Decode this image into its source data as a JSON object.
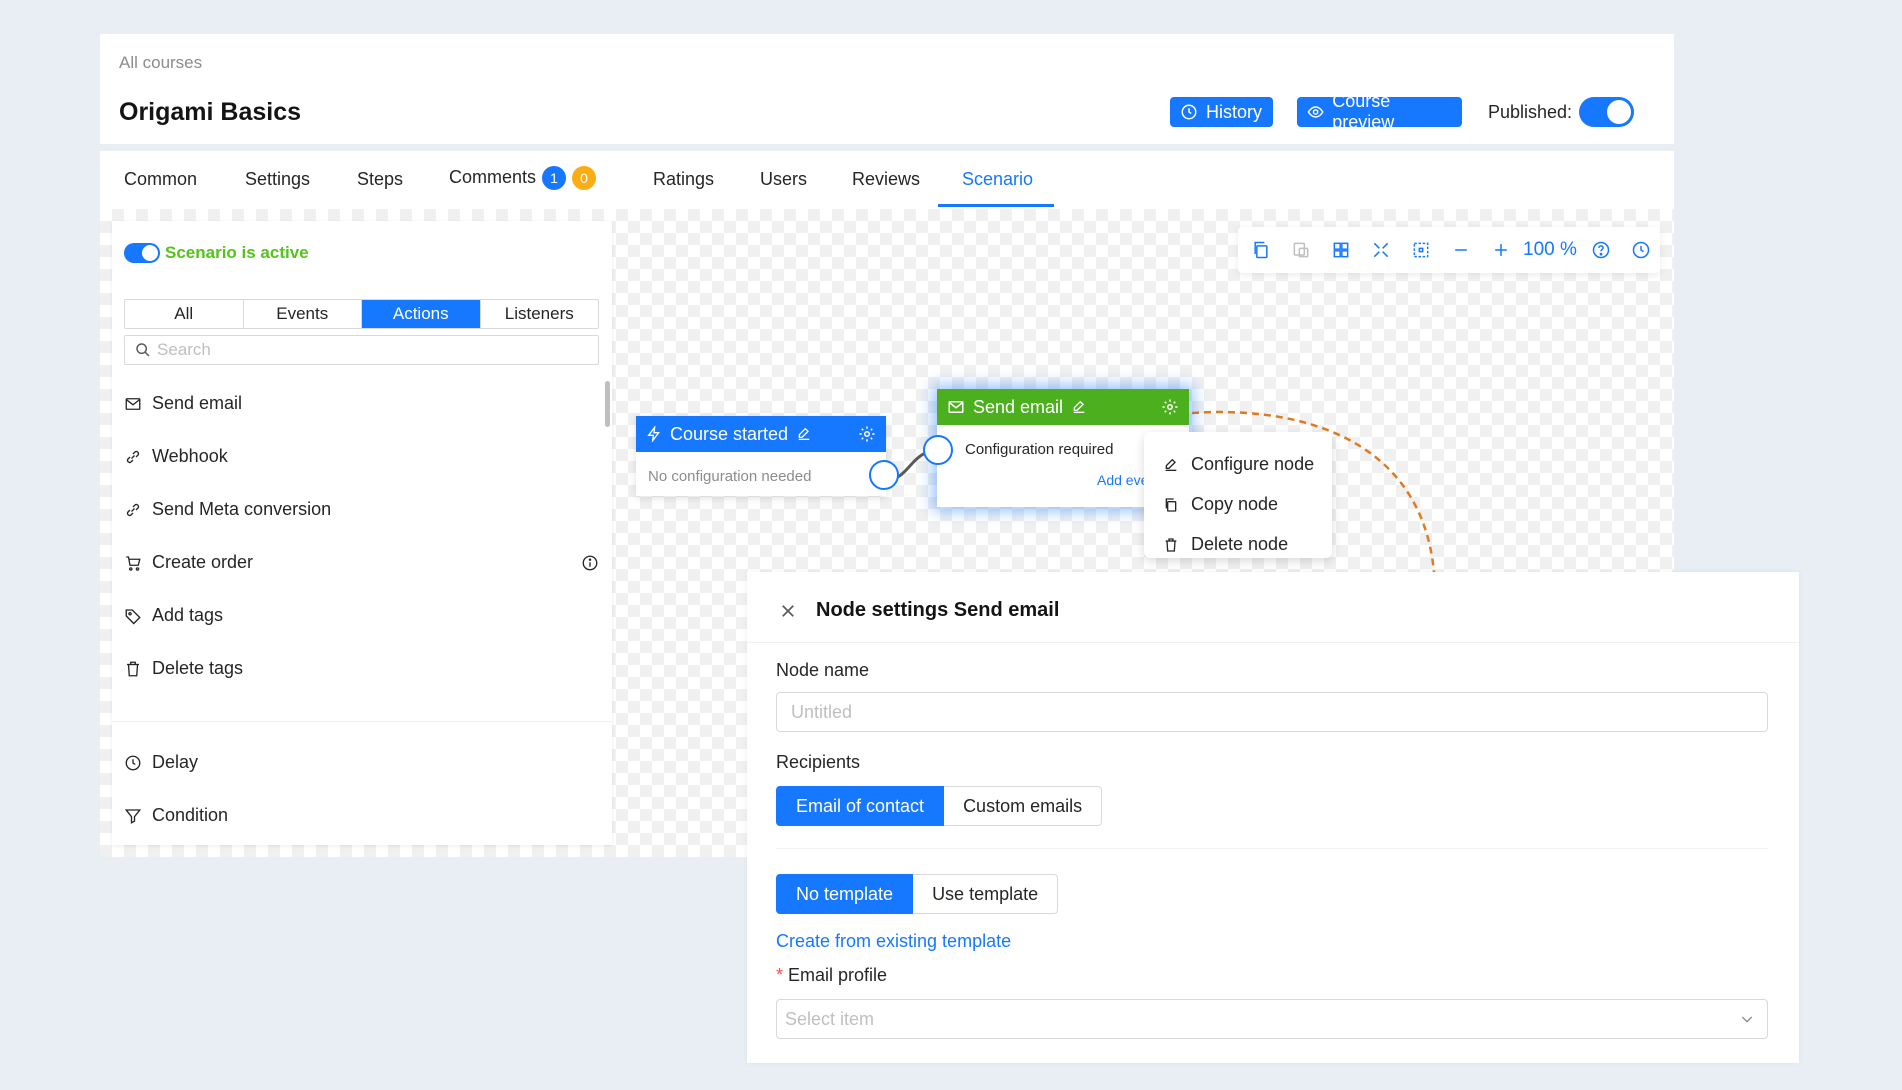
{
  "header": {
    "breadcrumb": "All courses",
    "title": "Origami Basics",
    "history_label": "History",
    "preview_label": "Course preview",
    "published_label": "Published:",
    "published": true
  },
  "tabs": [
    {
      "label": "Common"
    },
    {
      "label": "Settings"
    },
    {
      "label": "Steps"
    },
    {
      "label": "Comments",
      "badges": [
        "1",
        "0"
      ]
    },
    {
      "label": "Ratings"
    },
    {
      "label": "Users"
    },
    {
      "label": "Reviews"
    },
    {
      "label": "Scenario",
      "active": true
    }
  ],
  "colors": {
    "primary": "#1677ff",
    "success": "#52c41a",
    "node_green": "#4caf1e",
    "badge_blue": "#1677ff",
    "badge_orange": "#faad14",
    "connector_orange": "#e07a1f"
  },
  "panel": {
    "scenario_active_label": "Scenario is active",
    "filters": [
      {
        "label": "All"
      },
      {
        "label": "Events"
      },
      {
        "label": "Actions",
        "active": true
      },
      {
        "label": "Listeners"
      }
    ],
    "search_placeholder": "Search",
    "items": [
      {
        "label": "Send email",
        "icon": "mail-icon"
      },
      {
        "label": "Webhook",
        "icon": "link-icon"
      },
      {
        "label": "Send Meta conversion",
        "icon": "link-icon"
      },
      {
        "label": "Create order",
        "icon": "cart-icon",
        "info": true
      },
      {
        "label": "Add tags",
        "icon": "tag-icon"
      },
      {
        "label": "Delete tags",
        "icon": "trash-icon"
      }
    ],
    "flow_items": [
      {
        "label": "Delay",
        "icon": "clock-icon"
      },
      {
        "label": "Condition",
        "icon": "filter-icon"
      }
    ]
  },
  "toolbar": {
    "zoom": "100 %",
    "icons": [
      "copy-icon",
      "paste-icon",
      "grid-icon",
      "fit-icon",
      "select-icon",
      "zoom-out-icon",
      "zoom-in-icon",
      "help-icon",
      "history-icon"
    ]
  },
  "nodes": {
    "course_started": {
      "title": "Course started",
      "body": "No configuration needed"
    },
    "send_email": {
      "title": "Send email",
      "body": "Configuration required",
      "add_label": "Add eve"
    }
  },
  "context_menu": {
    "items": [
      {
        "label": "Configure node",
        "icon": "edit-icon"
      },
      {
        "label": "Copy node",
        "icon": "copy-icon"
      },
      {
        "label": "Delete node",
        "icon": "trash-icon"
      }
    ]
  },
  "drawer": {
    "title": "Node settings Send email",
    "node_name_label": "Node name",
    "node_name_placeholder": "Untitled",
    "recipients_label": "Recipients",
    "recipients_options": [
      {
        "label": "Email of contact",
        "active": true
      },
      {
        "label": "Custom emails"
      }
    ],
    "template_options": [
      {
        "label": "No template",
        "active": true
      },
      {
        "label": "Use template"
      }
    ],
    "create_link": "Create from existing template",
    "email_profile_required": "*",
    "email_profile_label": "Email profile",
    "email_profile_placeholder": "Select item"
  }
}
